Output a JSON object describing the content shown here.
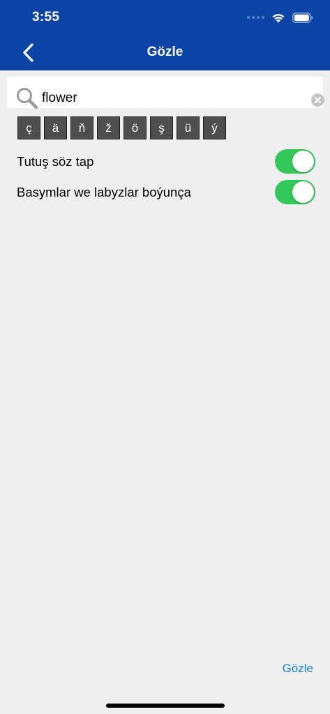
{
  "status_bar": {
    "time": "3:55"
  },
  "nav": {
    "title": "Gözle"
  },
  "search": {
    "value": "flower"
  },
  "special_chars": [
    "ç",
    "ä",
    "ň",
    "ž",
    "ö",
    "ş",
    "ü",
    "ý"
  ],
  "toggles": [
    {
      "label": "Tutuş söz tap",
      "on": true
    },
    {
      "label": "Basymlar we labyzlar boýunça",
      "on": true
    }
  ],
  "bottom": {
    "action_label": "Gözle"
  },
  "colors": {
    "header_bg": "#0c44a6",
    "toggle_on": "#34c759",
    "key_bg": "#4e4e4e",
    "link": "#1a7cd7",
    "page_bg": "#efefef"
  }
}
